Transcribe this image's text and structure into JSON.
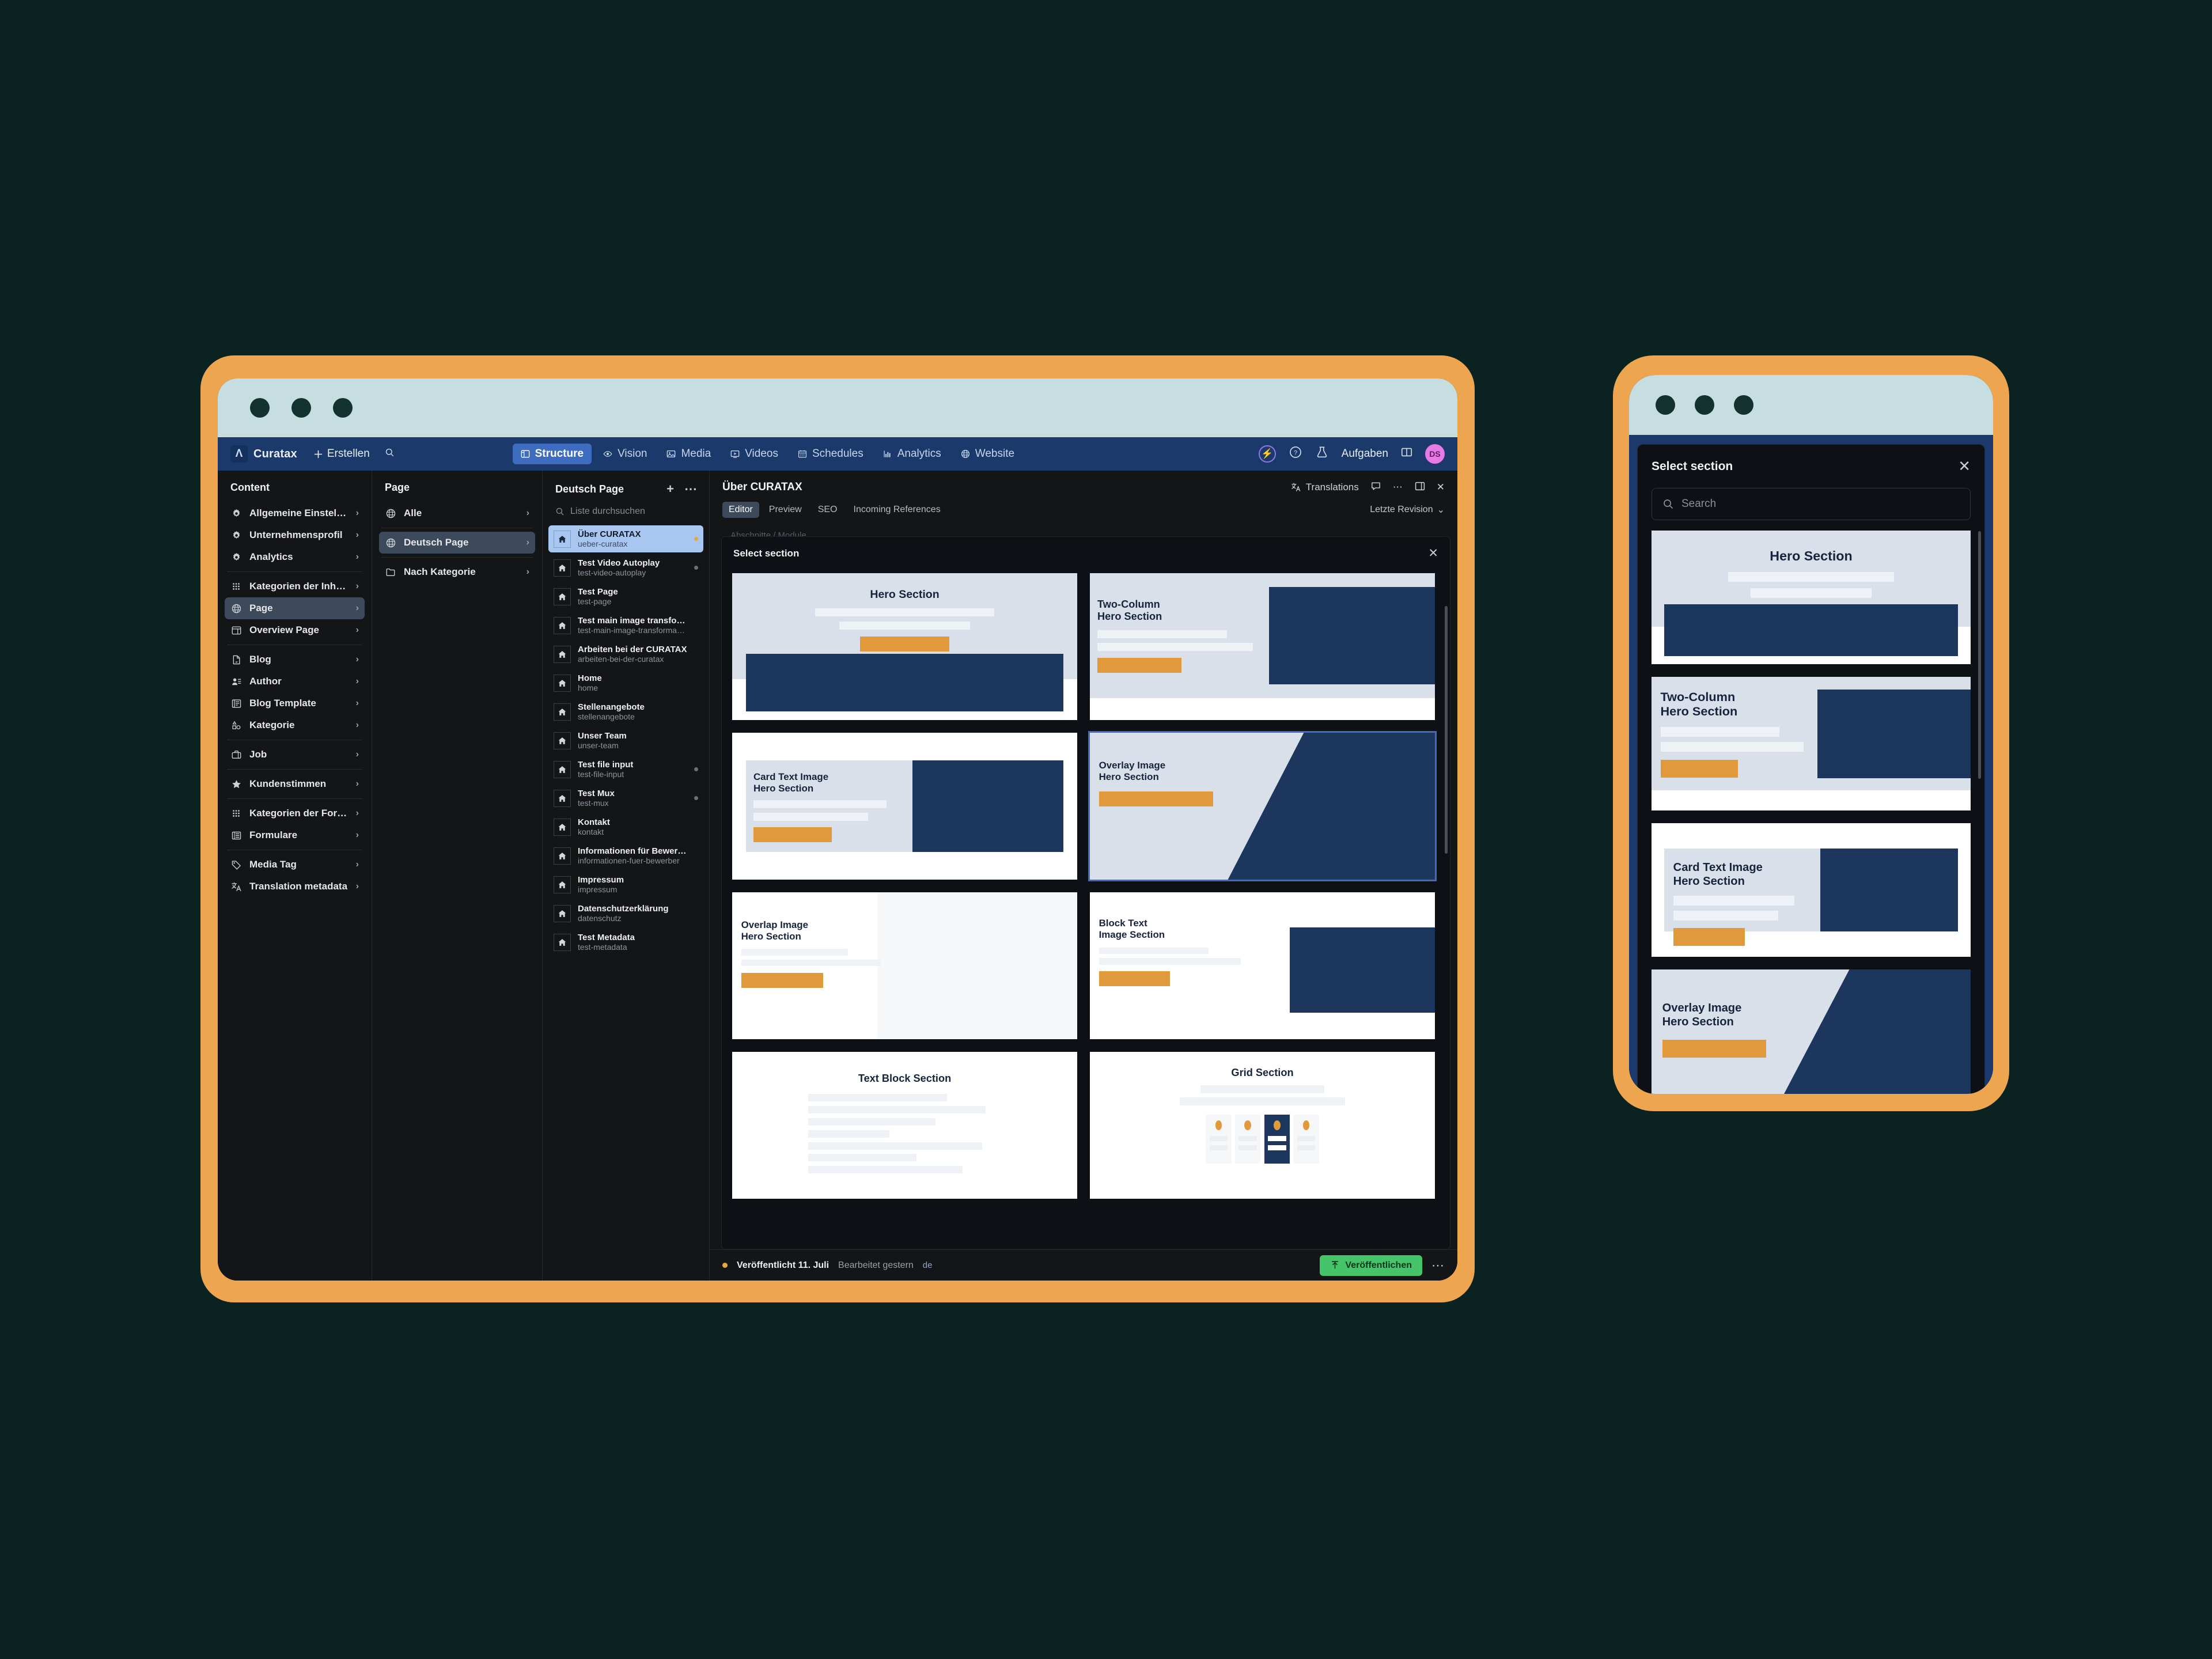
{
  "app": {
    "brand": "Curatax",
    "logo_glyph": "Λ",
    "create_label": "Erstellen",
    "search_icon": "search-icon"
  },
  "topnav": {
    "items": [
      {
        "label": "Structure",
        "icon": "structure-icon",
        "active": true
      },
      {
        "label": "Vision",
        "icon": "eye-icon",
        "active": false
      },
      {
        "label": "Media",
        "icon": "image-icon",
        "active": false
      },
      {
        "label": "Videos",
        "icon": "video-icon",
        "active": false
      },
      {
        "label": "Schedules",
        "icon": "calendar-icon",
        "active": false
      },
      {
        "label": "Analytics",
        "icon": "chart-icon",
        "active": false
      },
      {
        "label": "Website",
        "icon": "globe-icon",
        "active": false
      }
    ],
    "right": {
      "bolt_icon": "bolt-icon",
      "help_icon": "help-icon",
      "beaker_icon": "beaker-icon",
      "tasks_label": "Aufgaben",
      "panel_icon": "panel-icon",
      "avatar_initials": "DS"
    }
  },
  "content_panel": {
    "title": "Content",
    "items": [
      {
        "label": "Allgemeine Einstellungen",
        "icon": "gear-icon",
        "active": false,
        "divider_after": false
      },
      {
        "label": "Unternehmensprofil",
        "icon": "gear-icon",
        "active": false,
        "divider_after": false
      },
      {
        "label": "Analytics",
        "icon": "gear-icon",
        "active": false,
        "divider_after": true
      },
      {
        "label": "Kategorien der Inhaltsseiten",
        "icon": "grid-dots-icon",
        "active": false,
        "divider_after": false
      },
      {
        "label": "Page",
        "icon": "globe-icon",
        "active": true,
        "divider_after": false
      },
      {
        "label": "Overview Page",
        "icon": "layout-icon",
        "active": false,
        "divider_after": true
      },
      {
        "label": "Blog",
        "icon": "document-icon",
        "active": false,
        "divider_after": false
      },
      {
        "label": "Author",
        "icon": "person-icon",
        "active": false,
        "divider_after": false
      },
      {
        "label": "Blog Template",
        "icon": "template-icon",
        "active": false,
        "divider_after": false
      },
      {
        "label": "Kategorie",
        "icon": "shapes-icon",
        "active": false,
        "divider_after": true
      },
      {
        "label": "Job",
        "icon": "briefcase-icon",
        "active": false,
        "divider_after": true
      },
      {
        "label": "Kundenstimmen",
        "icon": "star-icon",
        "active": false,
        "divider_after": true
      },
      {
        "label": "Kategorien der Formulare",
        "icon": "grid-dots-icon",
        "active": false,
        "divider_after": false
      },
      {
        "label": "Formulare",
        "icon": "list-icon",
        "active": false,
        "divider_after": true
      },
      {
        "label": "Media Tag",
        "icon": "tag-icon",
        "active": false,
        "divider_after": false
      },
      {
        "label": "Translation metadata",
        "icon": "translate-icon",
        "active": false,
        "divider_after": false
      }
    ]
  },
  "page_panel": {
    "title": "Page",
    "items": [
      {
        "label": "Alle",
        "icon": "globe-icon",
        "active": false
      },
      {
        "label": "Deutsch Page",
        "icon": "globe-icon",
        "active": true
      },
      {
        "label": "Nach Kategorie",
        "icon": "folder-icon",
        "active": false
      }
    ]
  },
  "docs_panel": {
    "title": "Deutsch Page",
    "add_icon": "plus-icon",
    "more_icon": "more-icon",
    "search_placeholder": "Liste durchsuchen",
    "search_icon": "search-icon",
    "items": [
      {
        "title": "Über CURATAX",
        "slug": "ueber-curatax",
        "selected": true,
        "status": "amber"
      },
      {
        "title": "Test Video Autoplay",
        "slug": "test-video-autoplay",
        "selected": false,
        "status": "grey"
      },
      {
        "title": "Test Page",
        "slug": "test-page",
        "selected": false,
        "status": "none"
      },
      {
        "title": "Test main image transformat…",
        "slug": "test-main-image-transforma…",
        "selected": false,
        "status": "none"
      },
      {
        "title": "Arbeiten bei der CURATAX",
        "slug": "arbeiten-bei-der-curatax",
        "selected": false,
        "status": "none"
      },
      {
        "title": "Home",
        "slug": "home",
        "selected": false,
        "status": "none"
      },
      {
        "title": "Stellenangebote",
        "slug": "stellenangebote",
        "selected": false,
        "status": "none"
      },
      {
        "title": "Unser Team",
        "slug": "unser-team",
        "selected": false,
        "status": "none"
      },
      {
        "title": "Test file input",
        "slug": "test-file-input",
        "selected": false,
        "status": "grey"
      },
      {
        "title": "Test Mux",
        "slug": "test-mux",
        "selected": false,
        "status": "grey"
      },
      {
        "title": "Kontakt",
        "slug": "kontakt",
        "selected": false,
        "status": "none"
      },
      {
        "title": "Informationen für Bewerber",
        "slug": "informationen-fuer-bewerber",
        "selected": false,
        "status": "none"
      },
      {
        "title": "Impressum",
        "slug": "impressum",
        "selected": false,
        "status": "none"
      },
      {
        "title": "Datenschutzerklärung",
        "slug": "datenschutz",
        "selected": false,
        "status": "none"
      },
      {
        "title": "Test Metadata",
        "slug": "test-metadata",
        "selected": false,
        "status": "none"
      }
    ]
  },
  "editor": {
    "title": "Über CURATAX",
    "translations_label": "Translations",
    "translations_icon": "translate-icon",
    "comment_icon": "comment-icon",
    "more_icon": "more-icon",
    "panel_icon": "panel-icon",
    "close_icon": "close-icon",
    "tabs": [
      {
        "label": "Editor",
        "active": true
      },
      {
        "label": "Preview",
        "active": false
      },
      {
        "label": "SEO",
        "active": false
      },
      {
        "label": "Incoming References",
        "active": false
      }
    ],
    "revision_label": "Letzte Revision",
    "revision_chevron": "chevron-down-icon",
    "ghost_field": "Abschnitte / Module"
  },
  "select_section_modal": {
    "title": "Select section",
    "close_icon": "close-icon",
    "cards": [
      {
        "name": "Hero Section",
        "layout": "hero-centered",
        "selected": false,
        "bg": "#ffffff"
      },
      {
        "name": "Two-Column Hero Section",
        "layout": "two-column",
        "selected": false,
        "bg": "#ffffff"
      },
      {
        "name": "Card Text Image Hero Section",
        "layout": "card-text-image",
        "selected": false,
        "bg": "#ffffff"
      },
      {
        "name": "Overlay Image Hero Section",
        "layout": "overlay-image",
        "selected": true,
        "bg": "#ffffff"
      },
      {
        "name": "Overlap Image Hero Section",
        "layout": "overlap-image",
        "selected": false,
        "bg": "#ffffff"
      },
      {
        "name": "Block Text Image Section",
        "layout": "block-text-image",
        "selected": false,
        "bg": "#ffffff"
      },
      {
        "name": "Text Block Section",
        "layout": "text-block",
        "selected": false,
        "bg": "#ffffff"
      },
      {
        "name": "Grid Section",
        "layout": "grid",
        "selected": false,
        "bg": "#ffffff"
      }
    ]
  },
  "statusbar": {
    "dot_color": "#e3a93a",
    "published_label": "Veröffentlicht 11. Juli",
    "edited_label": "Bearbeitet gestern",
    "language": "de",
    "publish_button": "Veröffentlichen",
    "publish_icon": "upload-icon",
    "more_icon": "more-icon"
  },
  "phone": {
    "modal_title": "Select section",
    "close_icon": "close-icon",
    "search_placeholder": "Search",
    "search_icon": "search-icon",
    "cards": [
      {
        "name": "Hero Section",
        "layout": "hero-centered"
      },
      {
        "name": "Two-Column Hero Section",
        "layout": "two-column"
      },
      {
        "name": "Card Text Image Hero Section",
        "layout": "card-text-image"
      },
      {
        "name": "Overlay Image Hero Section",
        "layout": "overlay-image"
      }
    ]
  },
  "colors": {
    "device_frame": "#eda54f",
    "titlebar": "#c6dee0",
    "page_background": "#0a2320",
    "nav_blue": "#1b3a6b",
    "accent_blue": "#3d6cc0",
    "section_navy": "#1d365e",
    "section_orange": "#e09a3c",
    "publish_green": "#45c46a",
    "selected_row": "#a8c6f0"
  }
}
